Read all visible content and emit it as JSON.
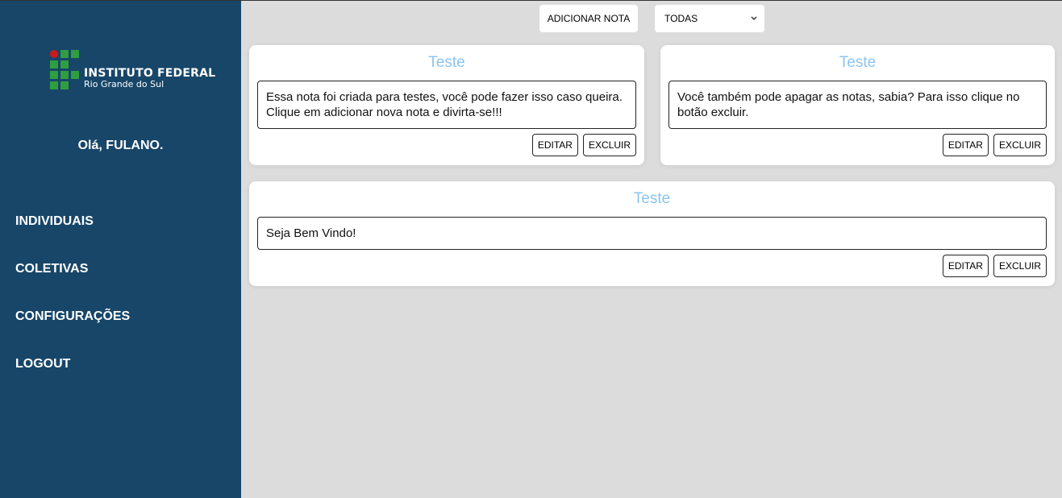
{
  "sidebar": {
    "logo": {
      "title": "INSTITUTO FEDERAL",
      "subtitle": "Rio Grande do Sul"
    },
    "greeting": "Olá, FULANO.",
    "nav": [
      {
        "label": "INDIVIDUAIS"
      },
      {
        "label": "COLETIVAS"
      },
      {
        "label": "CONFIGURAÇÕES"
      },
      {
        "label": "LOGOUT"
      }
    ]
  },
  "toolbar": {
    "add_label": "ADICIONAR NOTA",
    "filter_value": "TODAS"
  },
  "notes": [
    {
      "title": "Teste",
      "body": "Essa nota foi criada para testes, você pode fazer isso caso queira. Clique em adicionar nova nota e divirta-se!!!",
      "edit_label": "EDITAR",
      "delete_label": "EXCLUIR"
    },
    {
      "title": "Teste",
      "body": "Você também pode apagar as notas, sabia? Para isso clique no botão excluir.",
      "edit_label": "EDITAR",
      "delete_label": "EXCLUIR"
    },
    {
      "title": "Teste",
      "body": "Seja Bem Vindo!",
      "edit_label": "EDITAR",
      "delete_label": "EXCLUIR"
    }
  ],
  "colors": {
    "sidebar_bg": "#174669",
    "main_bg": "#dcdcdc",
    "note_title": "#8cc4f0",
    "logo_green": "#2f9e41",
    "logo_red": "#cd191e"
  }
}
